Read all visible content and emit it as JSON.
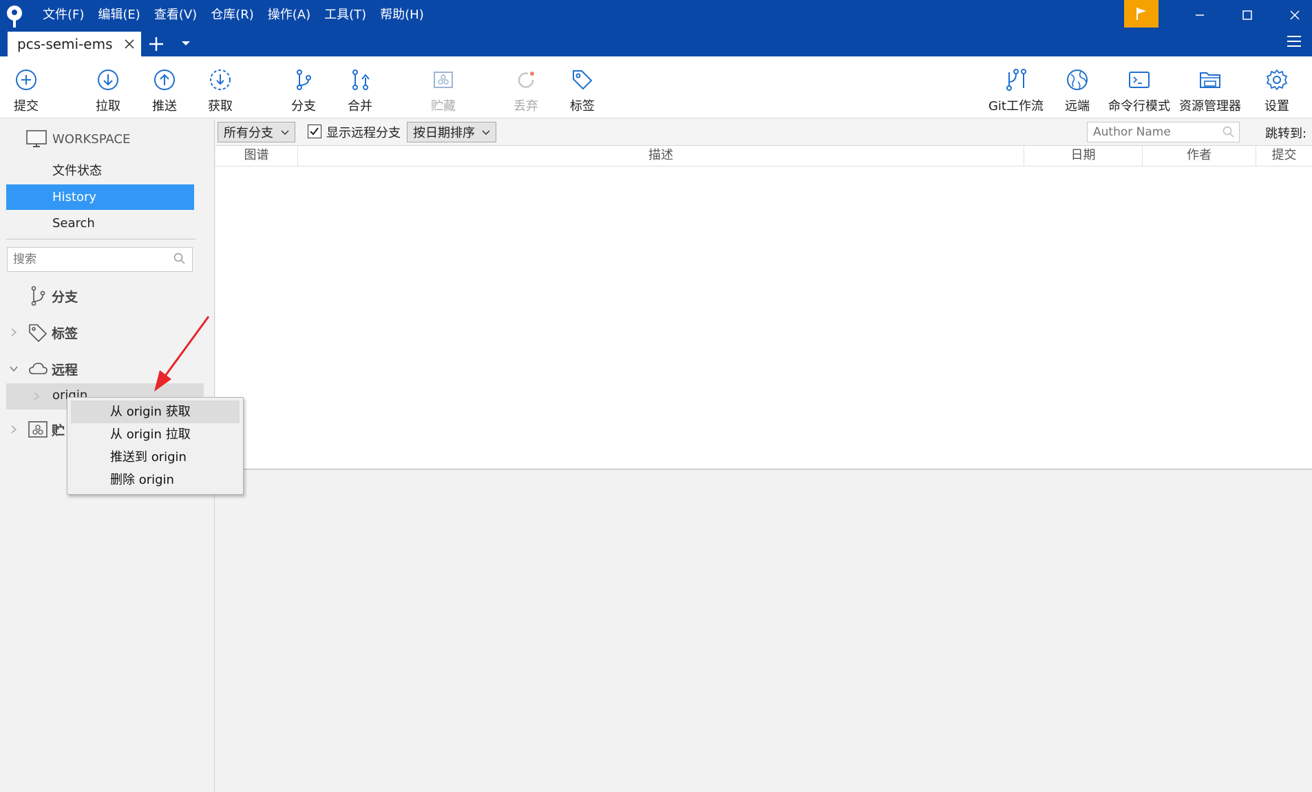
{
  "menu": [
    "文件(F)",
    "编辑(E)",
    "查看(V)",
    "仓库(R)",
    "操作(A)",
    "工具(T)",
    "帮助(H)"
  ],
  "tab": {
    "label": "pcs-semi-ems"
  },
  "toolbar": {
    "commit": "提交",
    "pull": "拉取",
    "push": "推送",
    "fetch": "获取",
    "branch": "分支",
    "merge": "合并",
    "stash": "贮藏",
    "discard": "丢弃",
    "tag": "标签",
    "gitflow": "Git工作流",
    "remote": "远端",
    "terminal": "命令行模式",
    "explorer": "资源管理器",
    "settings": "设置"
  },
  "sidebar": {
    "workspace": "WORKSPACE",
    "items": [
      "文件状态",
      "History",
      "Search"
    ],
    "search_placeholder": "搜索",
    "groups": {
      "branches": "分支",
      "tags": "标签",
      "remotes": "远程",
      "stashes": "贮"
    },
    "remote_item": "origin"
  },
  "context_menu": [
    "从 origin 获取",
    "从 origin 拉取",
    "推送到 origin",
    "删除 origin"
  ],
  "filterbar": {
    "branches_dropdown": "所有分支",
    "show_remote_label": "显示远程分支",
    "show_remote_checked": true,
    "sort_dropdown": "按日期排序",
    "author_placeholder": "Author Name",
    "jump_label": "跳转到:"
  },
  "table": {
    "columns": [
      "图谱",
      "描述",
      "日期",
      "作者",
      "提交"
    ],
    "rows": []
  },
  "colors": {
    "titlebar": "#0a48a8",
    "accent": "#3398f5",
    "flag": "#f5a200",
    "annotation_arrow": "#e8252a"
  },
  "icons": {
    "commit": "plus-circle-icon",
    "pull": "arrow-down-circle-icon",
    "push": "arrow-up-circle-icon",
    "fetch": "dashed-arrow-down-circle-icon",
    "branch": "branch-icon",
    "merge": "merge-icon",
    "stash": "stash-box-icon",
    "discard": "undo-icon",
    "tag": "tag-icon",
    "gitflow": "gitflow-icon",
    "remote": "globe-icon",
    "terminal": "terminal-icon",
    "explorer": "folder-icon",
    "settings": "gear-icon"
  }
}
